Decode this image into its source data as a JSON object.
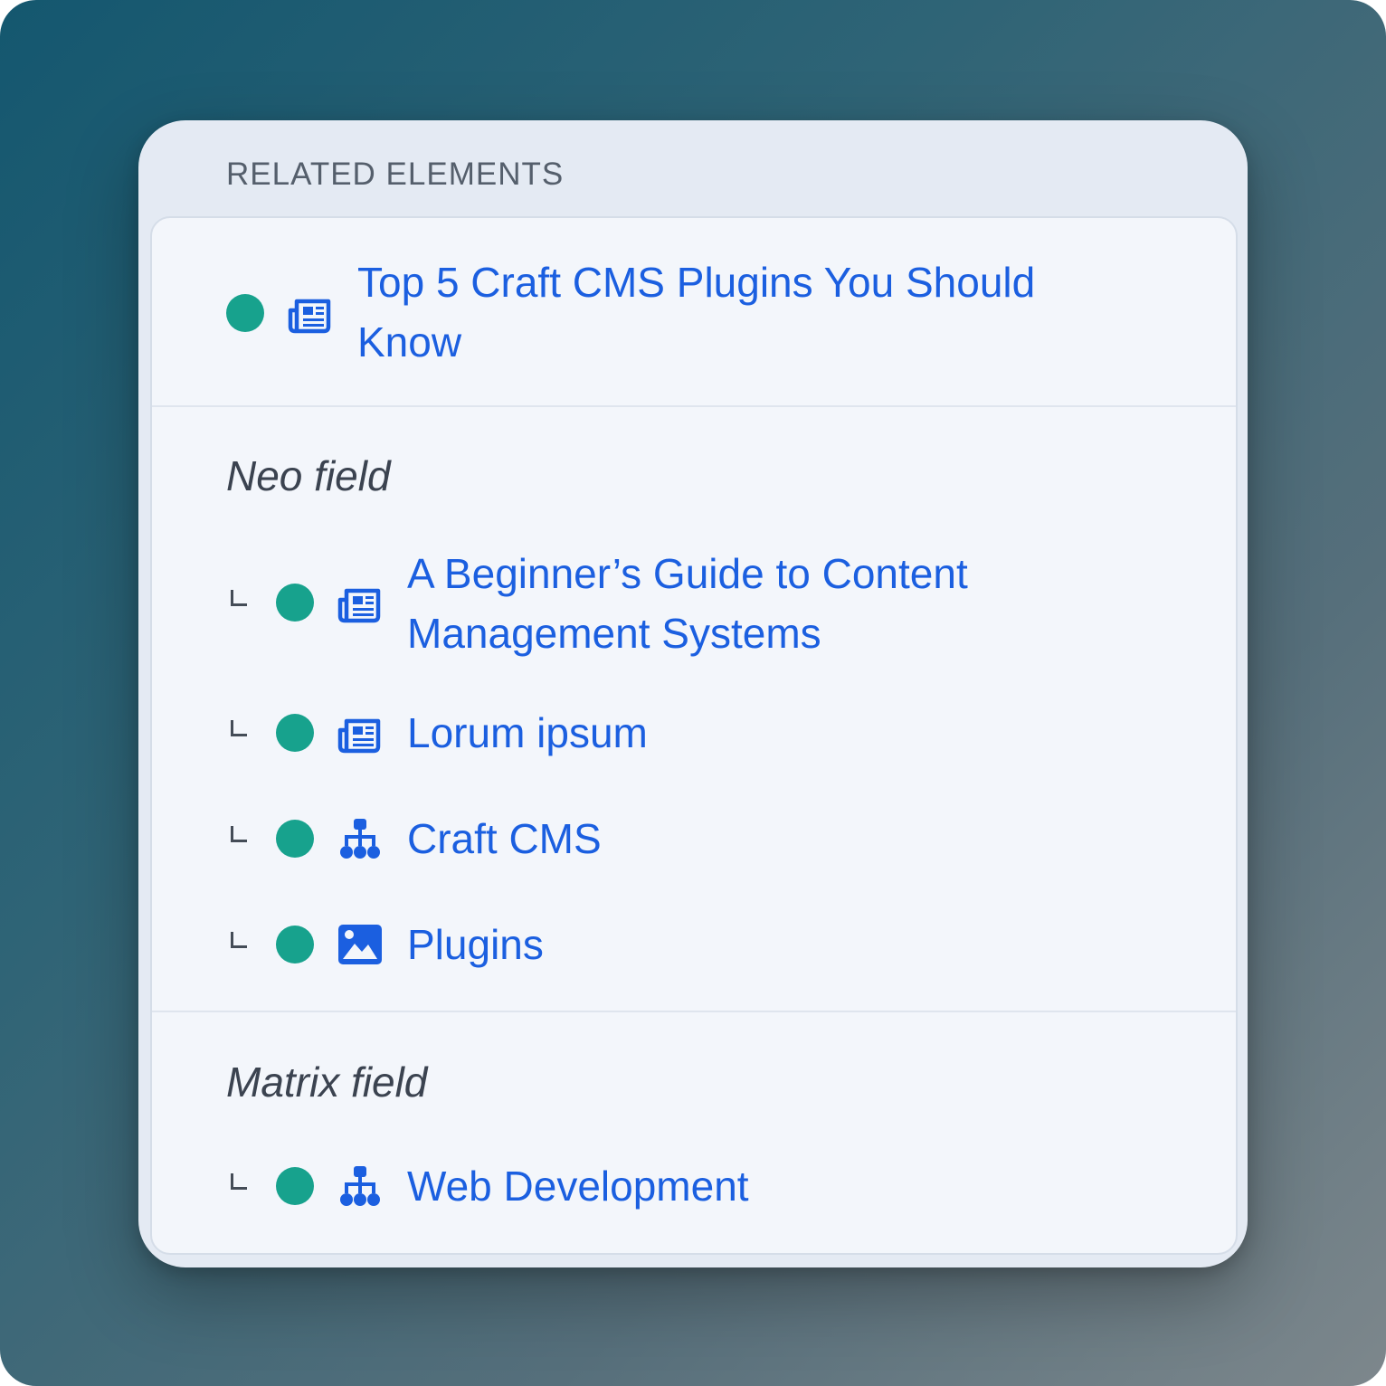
{
  "panel": {
    "title": "RELATED ELEMENTS"
  },
  "colors": {
    "status_dot": "#17a28d",
    "link": "#1b5fe0",
    "icon": "#1b5fe0"
  },
  "top_item": {
    "line1": "Top 5 Craft CMS Plugins You Should",
    "line2": "Know",
    "icon": "newspaper-icon",
    "status": "enabled"
  },
  "sections": [
    {
      "heading": "Neo field",
      "items": [
        {
          "line1": "A Beginner’s Guide to Content",
          "line2": "Management Systems",
          "icon": "newspaper-icon",
          "status": "enabled"
        },
        {
          "label": "Lorum ipsum",
          "icon": "newspaper-icon",
          "status": "enabled"
        },
        {
          "label": "Craft CMS",
          "icon": "sitemap-icon",
          "status": "enabled"
        },
        {
          "label": "Plugins",
          "icon": "image-icon",
          "status": "enabled"
        }
      ]
    },
    {
      "heading": "Matrix field",
      "items": [
        {
          "label": "Web Development",
          "icon": "sitemap-icon",
          "status": "enabled"
        }
      ]
    }
  ]
}
